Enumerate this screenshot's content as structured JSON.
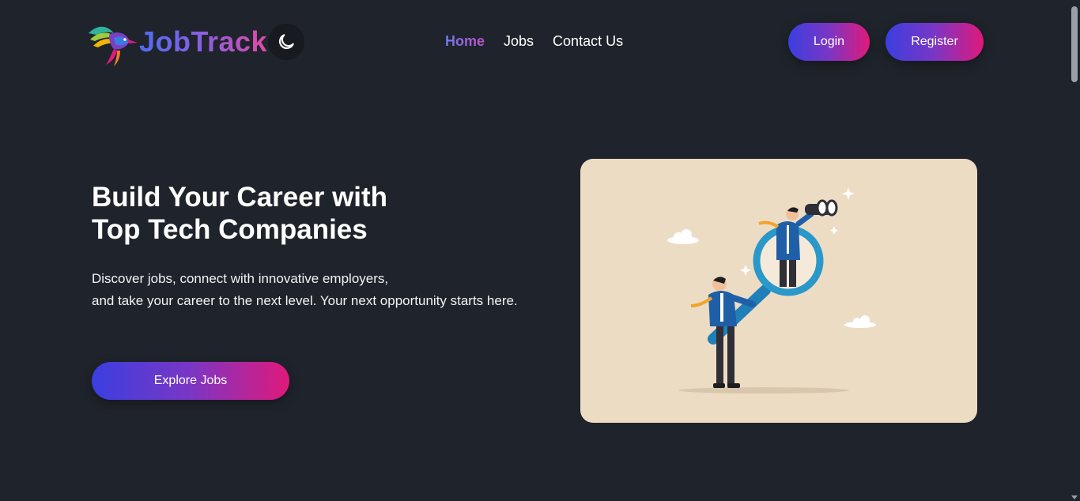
{
  "brand": {
    "name": "JobTrack",
    "logo_icon": "hummingbird-logo-icon"
  },
  "theme_toggle": {
    "icon": "moon-icon"
  },
  "nav": [
    {
      "label": "Home",
      "active": true
    },
    {
      "label": "Jobs",
      "active": false
    },
    {
      "label": "Contact Us",
      "active": false
    }
  ],
  "auth": {
    "login_label": "Login",
    "register_label": "Register"
  },
  "hero": {
    "title_line1": "Build Your Career with",
    "title_line2": "Top Tech Companies",
    "text_line1": "Discover jobs, connect with innovative employers,",
    "text_line2": "and take your career to the next level. Your next opportunity starts here.",
    "cta_label": "Explore Jobs"
  },
  "illustration": {
    "icon": "career-search-illustration"
  },
  "colors": {
    "background": "#1f232b",
    "gradient_start": "#3b3fe0",
    "gradient_end": "#e0197b",
    "illustration_bg": "#eddcc4"
  }
}
